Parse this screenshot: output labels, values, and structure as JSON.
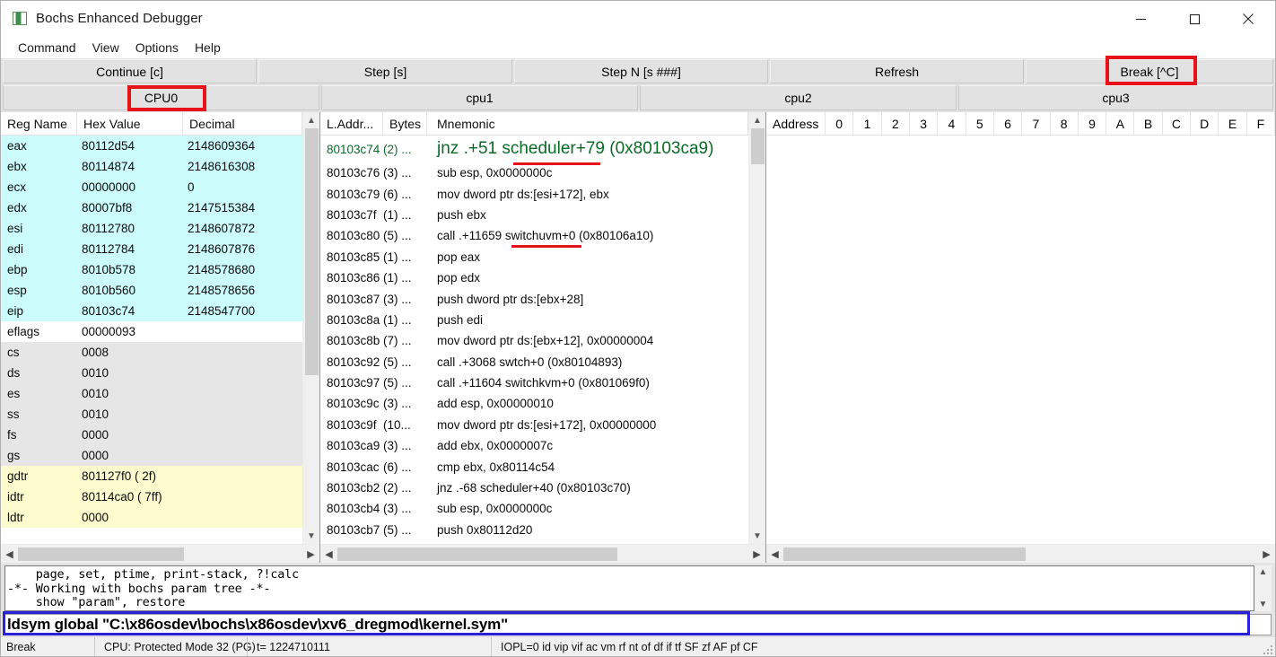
{
  "window": {
    "title": "Bochs Enhanced Debugger",
    "icon": "bochs-app-icon",
    "controls": {
      "minimize": "minimize-icon",
      "maximize": "maximize-icon",
      "close": "close-icon"
    }
  },
  "menubar": {
    "items": [
      "Command",
      "View",
      "Options",
      "Help"
    ]
  },
  "toolbar": {
    "buttons": [
      "Continue [c]",
      "Step [s]",
      "Step N [s ###]",
      "Refresh",
      "Break [^C]"
    ]
  },
  "cpu_tabs": {
    "tabs": [
      "CPU0",
      "cpu1",
      "cpu2",
      "cpu3"
    ],
    "active": "CPU0"
  },
  "registers": {
    "columns": [
      "Reg Name",
      "Hex Value",
      "Decimal"
    ],
    "rows": [
      {
        "name": "eax",
        "hex": "80112d54",
        "dec": "2148609364",
        "group": "gp"
      },
      {
        "name": "ebx",
        "hex": "80114874",
        "dec": "2148616308",
        "group": "gp"
      },
      {
        "name": "ecx",
        "hex": "00000000",
        "dec": "0",
        "group": "gp"
      },
      {
        "name": "edx",
        "hex": "80007bf8",
        "dec": "2147515384",
        "group": "gp"
      },
      {
        "name": "esi",
        "hex": "80112780",
        "dec": "2148607872",
        "group": "gp"
      },
      {
        "name": "edi",
        "hex": "80112784",
        "dec": "2148607876",
        "group": "gp"
      },
      {
        "name": "ebp",
        "hex": "8010b578",
        "dec": "2148578680",
        "group": "gp"
      },
      {
        "name": "esp",
        "hex": "8010b560",
        "dec": "2148578656",
        "group": "gp"
      },
      {
        "name": "eip",
        "hex": "80103c74",
        "dec": "2148547700",
        "group": "gp"
      },
      {
        "name": "eflags",
        "hex": "00000093",
        "dec": "",
        "group": "fl"
      },
      {
        "name": "cs",
        "hex": "0008",
        "dec": "",
        "group": "seg"
      },
      {
        "name": "ds",
        "hex": "0010",
        "dec": "",
        "group": "seg"
      },
      {
        "name": "es",
        "hex": "0010",
        "dec": "",
        "group": "seg"
      },
      {
        "name": "ss",
        "hex": "0010",
        "dec": "",
        "group": "seg"
      },
      {
        "name": "fs",
        "hex": "0000",
        "dec": "",
        "group": "seg"
      },
      {
        "name": "gs",
        "hex": "0000",
        "dec": "",
        "group": "seg"
      },
      {
        "name": "gdtr",
        "hex": "801127f0 (  2f)",
        "dec": "",
        "group": "sys"
      },
      {
        "name": "idtr",
        "hex": "80114ca0 ( 7ff)",
        "dec": "",
        "group": "sys"
      },
      {
        "name": "ldtr",
        "hex": "0000",
        "dec": "",
        "group": "sys"
      }
    ]
  },
  "disassembly": {
    "columns": [
      "L.Addr...",
      "Bytes",
      "Mnemonic"
    ],
    "rows": [
      {
        "addr": "80103c74",
        "bytes": "(2) ...",
        "mnemonic": "jnz .+51 scheduler+79 (0x80103ca9)",
        "current": true
      },
      {
        "addr": "80103c76",
        "bytes": "(3) ...",
        "mnemonic": "sub esp, 0x0000000c",
        "current": false
      },
      {
        "addr": "80103c79",
        "bytes": "(6) ...",
        "mnemonic": "mov dword ptr ds:[esi+172], ebx",
        "current": false
      },
      {
        "addr": "80103c7f",
        "bytes": "(1) ...",
        "mnemonic": "push ebx",
        "current": false
      },
      {
        "addr": "80103c80",
        "bytes": "(5) ...",
        "mnemonic": "call .+11659 switchuvm+0 (0x80106a10)",
        "current": false
      },
      {
        "addr": "80103c85",
        "bytes": "(1) ...",
        "mnemonic": "pop eax",
        "current": false
      },
      {
        "addr": "80103c86",
        "bytes": "(1) ...",
        "mnemonic": "pop edx",
        "current": false
      },
      {
        "addr": "80103c87",
        "bytes": "(3) ...",
        "mnemonic": "push dword ptr ds:[ebx+28]",
        "current": false
      },
      {
        "addr": "80103c8a",
        "bytes": "(1) ...",
        "mnemonic": "push edi",
        "current": false
      },
      {
        "addr": "80103c8b",
        "bytes": "(7) ...",
        "mnemonic": "mov dword ptr ds:[ebx+12], 0x00000004",
        "current": false
      },
      {
        "addr": "80103c92",
        "bytes": "(5) ...",
        "mnemonic": "call .+3068 swtch+0 (0x80104893)",
        "current": false
      },
      {
        "addr": "80103c97",
        "bytes": "(5) ...",
        "mnemonic": "call .+11604 switchkvm+0 (0x801069f0)",
        "current": false
      },
      {
        "addr": "80103c9c",
        "bytes": "(3) ...",
        "mnemonic": "add esp, 0x00000010",
        "current": false
      },
      {
        "addr": "80103c9f",
        "bytes": "(10...",
        "mnemonic": "mov dword ptr ds:[esi+172], 0x00000000",
        "current": false
      },
      {
        "addr": "80103ca9",
        "bytes": "(3) ...",
        "mnemonic": "add ebx, 0x0000007c",
        "current": false
      },
      {
        "addr": "80103cac",
        "bytes": "(6) ...",
        "mnemonic": "cmp ebx, 0x80114c54",
        "current": false
      },
      {
        "addr": "80103cb2",
        "bytes": "(2) ...",
        "mnemonic": "jnz .-68 scheduler+40 (0x80103c70)",
        "current": false
      },
      {
        "addr": "80103cb4",
        "bytes": "(3) ...",
        "mnemonic": "sub esp, 0x0000000c",
        "current": false
      },
      {
        "addr": "80103cb7",
        "bytes": "(5) ...",
        "mnemonic": "push 0x80112d20",
        "current": false
      }
    ]
  },
  "memory": {
    "columns": [
      "Address",
      "0",
      "1",
      "2",
      "3",
      "4",
      "5",
      "6",
      "7",
      "8",
      "9",
      "A",
      "B",
      "C",
      "D",
      "E",
      "F"
    ],
    "rows": []
  },
  "console": {
    "lines": [
      "    page, set, ptime, print-stack, ?!calc",
      "-*- Working with bochs param tree -*-",
      "    show \"param\", restore"
    ]
  },
  "command_input": {
    "value": "ldsym global \"C:\\x86osdev\\bochs\\x86osdev\\xv6_dregmod\\kernel.sym\"",
    "placeholder": ""
  },
  "statusbar": {
    "state": "Break",
    "cpu_mode": "CPU: Protected Mode 32 (PG)",
    "ticks": "t= 1224710111",
    "flags": "IOPL=0 id vip vif ac vm rf nt of df if tf SF zf AF pf CF"
  },
  "annotations": {
    "red_boxes": [
      "break-button",
      "cpu0-tab"
    ],
    "red_underlines": [
      "scheduler-symbol",
      "switchuvm-symbol"
    ],
    "blue_box": "command-input",
    "colors": {
      "red": "#e8121a",
      "blue": "#2a21d8",
      "current_line": "#0a6b26"
    }
  }
}
